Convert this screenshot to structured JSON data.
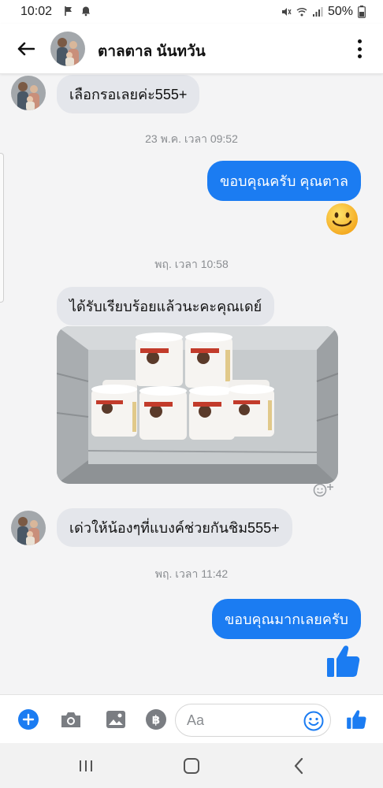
{
  "status_bar": {
    "time": "10:02",
    "battery": "50%"
  },
  "header": {
    "contact_name": "ตาลตาล นันทวัน"
  },
  "messages": [
    {
      "type": "incoming",
      "text": "เลือกรอเลยค่ะ555+"
    },
    {
      "type": "timestamp",
      "text": "23 พ.ค. เวลา 09:52"
    },
    {
      "type": "outgoing",
      "text": "ขอบคุณครับ คุณตาล"
    },
    {
      "type": "emoji",
      "icon": "smiley-emoji"
    },
    {
      "type": "timestamp",
      "text": "พฤ. เวลา 10:58"
    },
    {
      "type": "incoming",
      "text": "ได้รับเรียบร้อยแล้วนะคะคุณเดย์"
    },
    {
      "type": "photo",
      "icon": "ice-cream-cups-in-freezer-photo"
    },
    {
      "type": "incoming",
      "text": "เด่วให้น้องๆที่แบงค์ช่วยกันชิม555+"
    },
    {
      "type": "timestamp",
      "text": "พฤ. เวลา 11:42"
    },
    {
      "type": "outgoing",
      "text": "ขอบคุณมากเลยครับ"
    },
    {
      "type": "like",
      "icon": "thumbs-up-icon"
    }
  ],
  "composer": {
    "placeholder": "Aa"
  },
  "colors": {
    "accent": "#1b7cf2",
    "incoming_bubble": "#e4e6eb",
    "chat_background": "#f4f4f5"
  }
}
